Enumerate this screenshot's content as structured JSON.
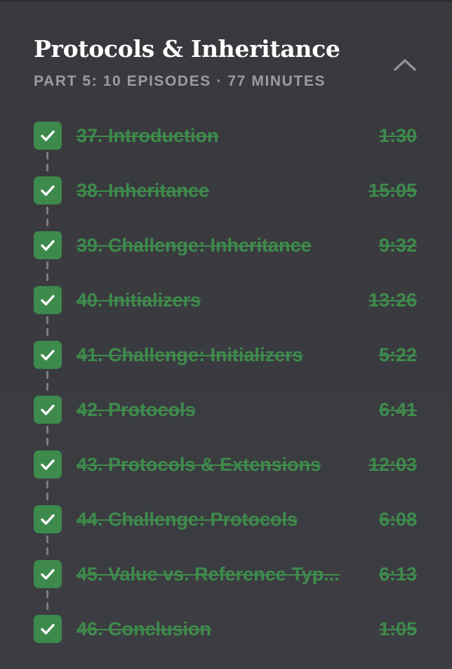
{
  "section": {
    "title": "Protocols & Inheritance",
    "subtitle": "PART 5: 10 EPISODES · 77 MINUTES",
    "collapse_icon": "chevron-up-icon"
  },
  "colors": {
    "background": "#3a3b3f",
    "completed_green": "#3e8b4c",
    "check_bg": "#3d8a4c",
    "subtitle_gray": "#9a9ca3"
  },
  "episodes": [
    {
      "label": "37. Introduction",
      "duration": "1:30",
      "completed": true
    },
    {
      "label": "38. Inheritance",
      "duration": "15:05",
      "completed": true
    },
    {
      "label": "39. Challenge: Inheritance",
      "duration": "9:32",
      "completed": true
    },
    {
      "label": "40. Initializers",
      "duration": "13:26",
      "completed": true
    },
    {
      "label": "41. Challenge: Initializers",
      "duration": "5:22",
      "completed": true
    },
    {
      "label": "42. Protocols",
      "duration": "6:41",
      "completed": true
    },
    {
      "label": "43. Protocols & Extensions",
      "duration": "12:03",
      "completed": true
    },
    {
      "label": "44. Challenge: Protocols",
      "duration": "6:08",
      "completed": true
    },
    {
      "label": "45. Value vs. Reference Typ...",
      "duration": "6:13",
      "completed": true
    },
    {
      "label": "46. Conclusion",
      "duration": "1:05",
      "completed": true
    }
  ]
}
